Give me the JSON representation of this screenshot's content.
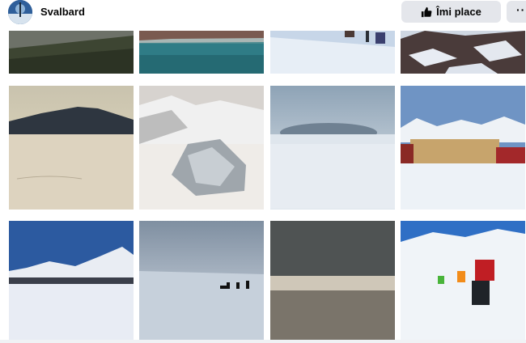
{
  "header": {
    "title": "Svalbard",
    "like_label": "Îmi place",
    "more_label": "···",
    "icons": {
      "avatar": "profile-photo",
      "like": "thumbs-up-icon",
      "more": "more-dots-icon"
    }
  },
  "photos": [
    {
      "name": "photo-tundra-valley",
      "subject": "tundra-valley"
    },
    {
      "name": "photo-fjord-cliffs",
      "subject": "fjord-cliffs"
    },
    {
      "name": "photo-skiers-snowfield",
      "subject": "skiers-snowfield"
    },
    {
      "name": "photo-rocky-snow",
      "subject": "rocky-snow"
    },
    {
      "name": "photo-sunlit-mountain-plain",
      "subject": "sunlit-mountain-plain"
    },
    {
      "name": "photo-ice-block-mountains",
      "subject": "ice-block-mountains"
    },
    {
      "name": "photo-windswept-hill",
      "subject": "windswept-hill"
    },
    {
      "name": "photo-settlement-buildings",
      "subject": "settlement-buildings"
    },
    {
      "name": "photo-blue-sky-mountains",
      "subject": "blue-sky-mountains"
    },
    {
      "name": "photo-dog-sled-team",
      "subject": "dog-sled-team"
    },
    {
      "name": "photo-grey-fog-horizon",
      "subject": "grey-fog-horizon"
    },
    {
      "name": "photo-person-sitting-snow",
      "subject": "person-sitting-snow"
    }
  ]
}
